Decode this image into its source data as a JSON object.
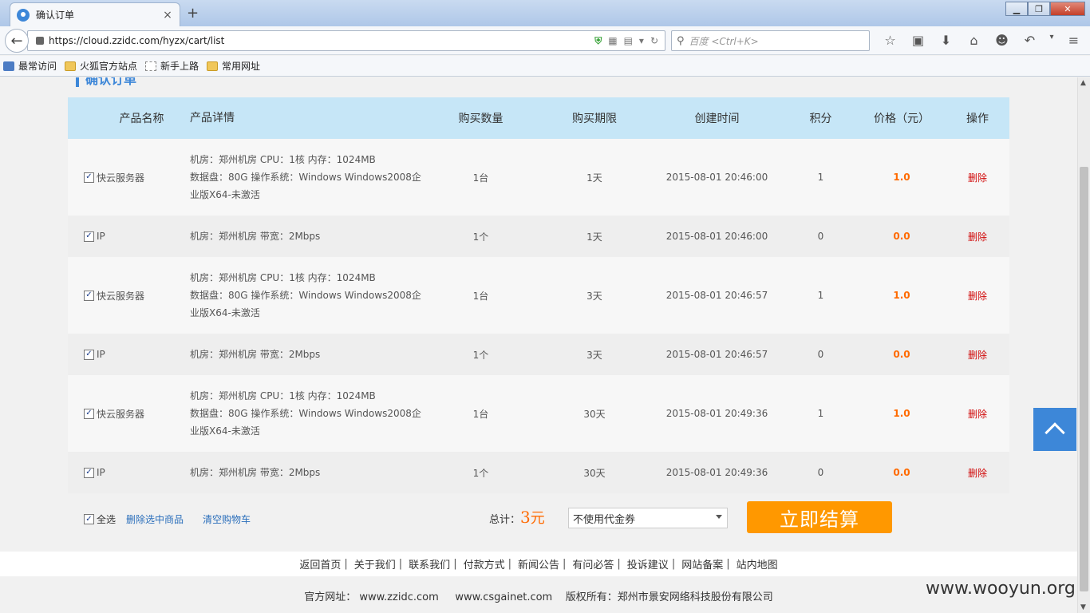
{
  "browser": {
    "tab_title": "确认订单",
    "tab_close": "×",
    "new_tab": "+",
    "url": "https://cloud.zzidc.com/hyzx/cart/list",
    "search_placeholder": "百度 <Ctrl+K>",
    "win_min": "▁",
    "win_max": "❐",
    "win_close": "✕",
    "bookmarks": [
      "最常访问",
      "火狐官方站点",
      "新手上路",
      "常用网址"
    ]
  },
  "page": {
    "section_title": "确认订单",
    "headers": {
      "name": "产品名称",
      "detail": "产品详情",
      "qty": "购买数量",
      "term": "购买期限",
      "time": "创建时间",
      "score": "积分",
      "price": "价格（元）",
      "op": "操作"
    },
    "rows": [
      {
        "name": "快云服务器",
        "detail": [
          "机房：郑州机房  CPU：1核  内存：1024MB",
          "数据盘：80G  操作系统：Windows Windows2008企",
          "业版X64-未激活"
        ],
        "qty": "1台",
        "term": "1天",
        "time": "2015-08-01 20:46:00",
        "score": "1",
        "price": "1.0",
        "op": "删除"
      },
      {
        "name": "IP",
        "detail": [
          "机房：郑州机房    带宽：2Mbps"
        ],
        "qty": "1个",
        "term": "1天",
        "time": "2015-08-01 20:46:00",
        "score": "0",
        "price": "0.0",
        "op": "删除"
      },
      {
        "name": "快云服务器",
        "detail": [
          "机房：郑州机房  CPU：1核  内存：1024MB",
          "数据盘：80G  操作系统：Windows Windows2008企",
          "业版X64-未激活"
        ],
        "qty": "1台",
        "term": "3天",
        "time": "2015-08-01 20:46:57",
        "score": "1",
        "price": "1.0",
        "op": "删除"
      },
      {
        "name": "IP",
        "detail": [
          "机房：郑州机房    带宽：2Mbps"
        ],
        "qty": "1个",
        "term": "3天",
        "time": "2015-08-01 20:46:57",
        "score": "0",
        "price": "0.0",
        "op": "删除"
      },
      {
        "name": "快云服务器",
        "detail": [
          "机房：郑州机房  CPU：1核  内存：1024MB",
          "数据盘：80G  操作系统：Windows Windows2008企",
          "业版X64-未激活"
        ],
        "qty": "1台",
        "term": "30天",
        "time": "2015-08-01 20:49:36",
        "score": "1",
        "price": "1.0",
        "op": "删除"
      },
      {
        "name": "IP",
        "detail": [
          "机房：郑州机房    带宽：2Mbps"
        ],
        "qty": "1个",
        "term": "30天",
        "time": "2015-08-01 20:49:36",
        "score": "0",
        "price": "0.0",
        "op": "删除"
      }
    ],
    "select_all": "全选",
    "delete_selected": "删除选中商品",
    "clear_cart": "清空购物车",
    "total_label": "总计：",
    "total_value": "3",
    "total_unit": "元",
    "coupon": "不使用代金券",
    "checkout": "立即结算"
  },
  "footer": {
    "links": [
      "返回首页",
      "关于我们",
      "联系我们",
      "付款方式",
      "新闻公告",
      "有问必答",
      "投诉建议",
      "网站备案",
      "站内地图"
    ],
    "separator": "|",
    "copyright": "官方网址： www.zzidc.com     www.csgainet.com    版权所有：郑州市景安网络科技股份有限公司"
  },
  "watermark": "www.wooyun.org",
  "colors": {
    "accent": "#3d87d8",
    "price": "#ff6a00",
    "checkout": "#ff9800",
    "delete": "#d10a0a",
    "header_bg": "#c6e6f7"
  }
}
